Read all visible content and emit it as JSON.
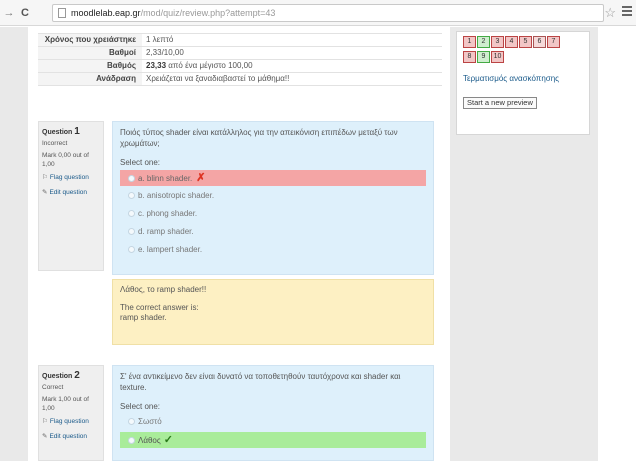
{
  "browser": {
    "url_host": "moodlelab.eap.gr",
    "url_path": "/mod/quiz/review.php?attempt=43"
  },
  "summary": [
    {
      "label": "Χρόνος που χρειάστηκε",
      "value": "1 λεπτό"
    },
    {
      "label": "Βαθμοί",
      "value": "2,33/10,00"
    },
    {
      "label": "Βαθμός",
      "value_strong": "23,33",
      "value": " από ένα μέγιστο 100,00"
    },
    {
      "label": "Ανάδραση",
      "value": "Χρειάζεται να ξαναδιαβαστεί το μάθημα!!"
    }
  ],
  "navigation": {
    "buttons": [
      "1",
      "2",
      "3",
      "4",
      "5",
      "6",
      "7",
      "8",
      "9",
      "10"
    ],
    "states": [
      "wrong",
      "right",
      "wrong",
      "wrong",
      "wrong",
      "partial",
      "wrong",
      "wrong",
      "right",
      "wrong"
    ],
    "finish_review": "Τερματισμός ανασκόπησης",
    "start_new_preview": "Start a new preview"
  },
  "questions": [
    {
      "label": "Question",
      "number": "1",
      "state": "Incorrect",
      "mark": "Mark 0,00 out of 1,00",
      "flag": "Flag question",
      "edit": "Edit question",
      "text": "Ποιός τύπος shader είναι κατάλληλος για την απεικόνιση επιπέδων μεταξύ των χρωμάτων;",
      "select_one": "Select one:",
      "answers": [
        "a. blinn shader.",
        "b. anisotropic shader.",
        "c. phong shader.",
        "d. ramp shader.",
        "e. lampert shader."
      ],
      "feedback": "Λάθος, το ramp shader!!",
      "correct_label": "The correct answer is:",
      "correct_answer": "ramp shader."
    },
    {
      "label": "Question",
      "number": "2",
      "state": "Correct",
      "mark": "Mark 1,00 out of 1,00",
      "flag": "Flag question",
      "edit": "Edit question",
      "text": "Σ' ένα αντικείμενο δεν είναι δυνατό να τοποθετηθούν ταυτόχρονα και shader και texture.",
      "select_one": "Select one:",
      "answers": [
        "Σωστό",
        "Λάθος"
      ]
    }
  ],
  "colors": {
    "incorrect_bg": "#f4a5a5",
    "correct_bg": "#a9ec9a",
    "question_bg": "#def0fb",
    "feedback_bg": "#fdf0c3"
  }
}
